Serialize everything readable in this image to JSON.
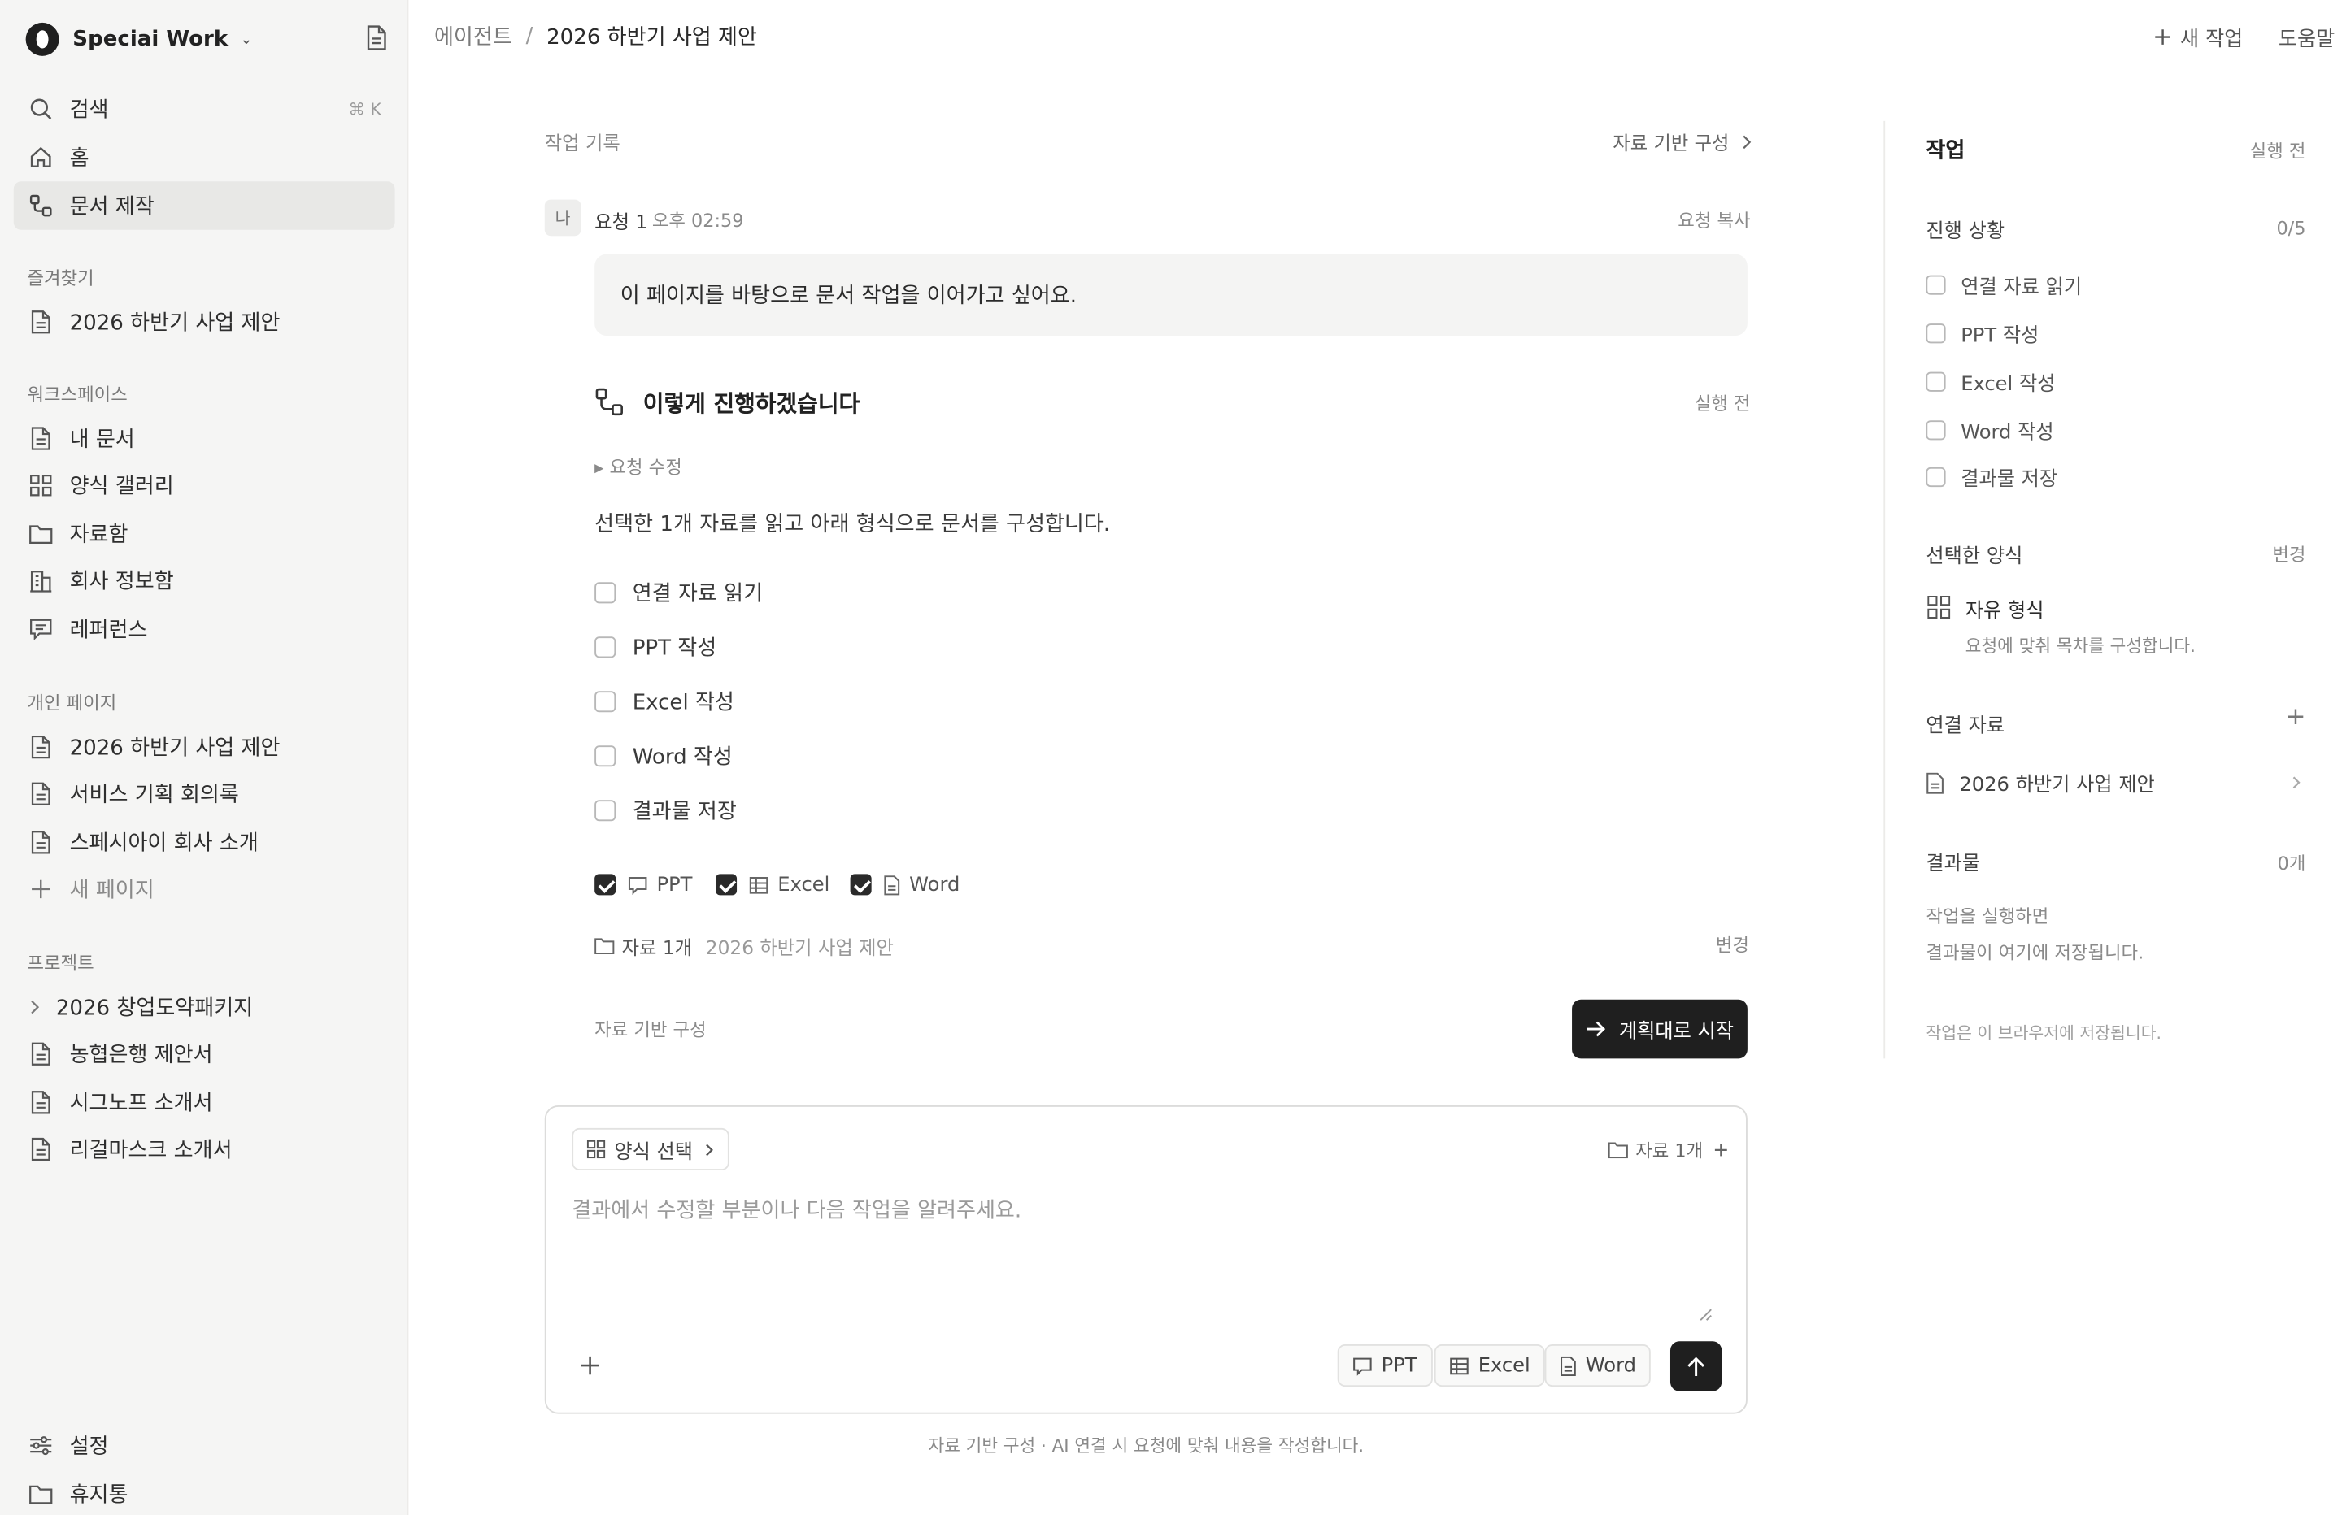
{
  "workspace": {
    "name": "Speciai Work"
  },
  "sidebar": {
    "search_label": "검색",
    "search_shortcut": "⌘ K",
    "home_label": "홈",
    "doc_make_label": "문서 제작",
    "favorites_heading": "즐겨찾기",
    "favorites": [
      {
        "label": "2026 하반기 사업 제안",
        "icon": "document-icon"
      }
    ],
    "workspace_heading": "워크스페이스",
    "workspace_items": [
      {
        "label": "내 문서",
        "icon": "document-icon"
      },
      {
        "label": "양식 갤러리",
        "icon": "grid-icon"
      },
      {
        "label": "자료함",
        "icon": "folder-icon"
      },
      {
        "label": "회사 정보함",
        "icon": "building-icon"
      },
      {
        "label": "레퍼런스",
        "icon": "chat-icon"
      }
    ],
    "personal_heading": "개인 페이지",
    "personal_items": [
      {
        "label": "2026 하반기 사업 제안",
        "icon": "document-icon"
      },
      {
        "label": "서비스 기획 회의록",
        "icon": "document-icon"
      },
      {
        "label": "스페시아이 회사 소개",
        "icon": "document-icon"
      }
    ],
    "new_page_label": "새 페이지",
    "project_heading": "프로젝트",
    "project_items": [
      {
        "label": "2026 창업도약패키지",
        "icon": "chevron-right-icon"
      },
      {
        "label": "농협은행 제안서",
        "icon": "document-icon"
      },
      {
        "label": "시그노프 소개서",
        "icon": "document-icon"
      },
      {
        "label": "리걸마스크 소개서",
        "icon": "document-icon"
      }
    ],
    "settings_label": "설정",
    "trash_label": "휴지통"
  },
  "header": {
    "breadcrumb_parent": "에이전트",
    "breadcrumb_sep": "/",
    "breadcrumb_current": "2026 하반기 사업 제안",
    "new_task_label": "새 작업",
    "help_label": "도움말"
  },
  "main": {
    "history_label": "작업 기록",
    "mode_link": "자료 기반 구성",
    "request": {
      "avatar": "나",
      "title": "요청 1",
      "time": "오후 02:59",
      "copy_label": "요청 복사",
      "text": "이 페이지를 바탕으로 문서 작업을 이어가고 싶어요."
    },
    "plan": {
      "title": "이렇게 진행하겠습니다",
      "status": "실행 전",
      "edit_toggle": "▸ 요청 수정",
      "description": "선택한 1개 자료를 읽고 아래 형식으로 문서를 구성합니다.",
      "steps": [
        "연결 자료 읽기",
        "PPT 작성",
        "Excel 작성",
        "Word 작성",
        "결과물 저장"
      ],
      "formats": [
        {
          "label": "PPT",
          "checked": true,
          "icon": "presentation-icon"
        },
        {
          "label": "Excel",
          "checked": true,
          "icon": "table-icon"
        },
        {
          "label": "Word",
          "checked": true,
          "icon": "document-icon"
        }
      ],
      "source_count": "자료 1개",
      "source_name": "2026 하반기 사업 제안",
      "change_label": "변경",
      "footer_mode": "자료 기반 구성",
      "start_label": "계획대로 시작"
    }
  },
  "composer": {
    "template_chip": "양식 선택",
    "source_chip": "자료 1개",
    "placeholder": "결과에서 수정할 부분이나 다음 작업을 알려주세요.",
    "format_chips": [
      "PPT",
      "Excel",
      "Word"
    ],
    "footer_note": "자료 기반 구성 · AI 연결 시 요청에 맞춰 내용을 작성합니다."
  },
  "panel": {
    "title": "작업",
    "status": "실행 전",
    "progress_label": "진행 상황",
    "progress_count": "0/5",
    "steps": [
      "연결 자료 읽기",
      "PPT 작성",
      "Excel 작성",
      "Word 작성",
      "결과물 저장"
    ],
    "template_heading": "선택한 양식",
    "template_change": "변경",
    "template_name": "자유 형식",
    "template_desc": "요청에 맞춰 목차를 구성합니다.",
    "linked_heading": "연결 자료",
    "linked_add": "+",
    "linked_item": "2026 하반기 사업 제안",
    "output_heading": "결과물",
    "output_count": "0개",
    "output_empty_1": "작업을 실행하면",
    "output_empty_2": "결과물이 여기에 저장됩니다.",
    "storage_note": "작업은 이 브라우저에 저장됩니다."
  },
  "colors": {
    "sidebar_bg": "#f5f5f4",
    "primary_button": "#1f1f1f",
    "active_item": "#e8e8e6"
  }
}
